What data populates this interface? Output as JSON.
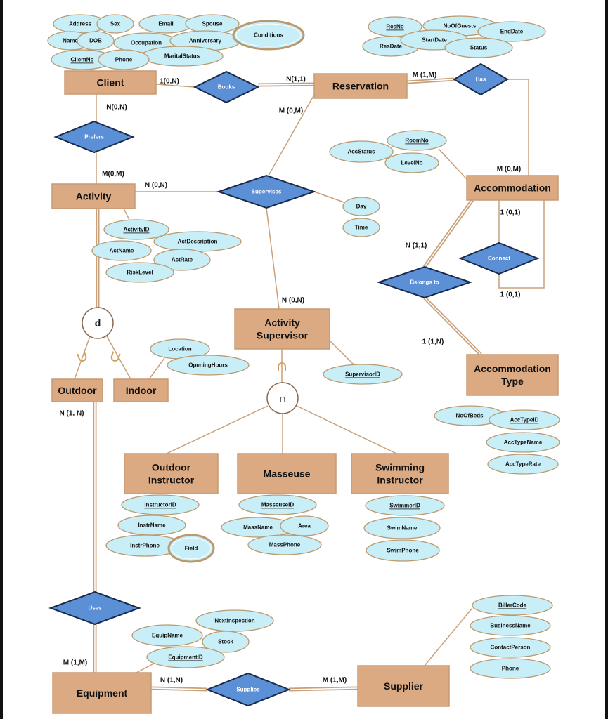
{
  "colors": {
    "entity_fill": "#dcaa82",
    "entity_stroke": "#c79a72",
    "relationship_fill": "#5b8fd6",
    "relationship_stroke": "#1a2a4a",
    "attribute_fill": "#c8eef8",
    "attribute_stroke": "#b99a70",
    "line": "#c8a07a"
  },
  "entities": {
    "client": "Client",
    "reservation": "Reservation",
    "accommodation": "Accommodation",
    "activity": "Activity",
    "activity_supervisor": "Activity Supervisor",
    "outdoor": "Outdoor",
    "indoor": "Indoor",
    "accommodation_type": "Accommodation Type",
    "outdoor_instructor": "Outdoor Instructor",
    "masseuse": "Masseuse",
    "swimming_instructor": "Swimming Instructor",
    "equipment": "Equipment",
    "supplier": "Supplier"
  },
  "relationships": {
    "books": "Books",
    "has": "Has",
    "prefers": "Prefers",
    "supervises": "Supervises",
    "connect": "Connect",
    "belongs_to": "Belongs to",
    "uses": "Uses",
    "supplies": "Supplies"
  },
  "specialization": {
    "disjoint": "d",
    "overlap": "∩"
  },
  "attributes": {
    "client": {
      "address": "Address",
      "sex": "Sex",
      "email": "Email",
      "spouse": "Spouse",
      "name": "Name",
      "dob": "DOB",
      "occupation": "Occupation",
      "anniversary": "Anniversary",
      "conditions": "Conditions",
      "client_no": "ClientNo",
      "phone": "Phone",
      "marital_status": "MaritalStatus"
    },
    "reservation": {
      "res_no": "ResNo",
      "no_of_guests": "NoOfGuests",
      "end_date": "EndDate",
      "res_date": "ResDate",
      "start_date": "StartDate",
      "status": "Status"
    },
    "accommodation": {
      "room_no": "RoomNo",
      "acc_status": "AccStatus",
      "level_no": "LevelNo"
    },
    "supervises": {
      "day": "Day",
      "time": "Time"
    },
    "activity": {
      "activity_id": "ActivityID",
      "act_description": "ActDescription",
      "act_name": "ActName",
      "act_rate": "ActRate",
      "risk_level": "RiskLevel"
    },
    "indoor": {
      "location": "Location",
      "opening_hours": "OpeningHours"
    },
    "activity_supervisor": {
      "supervisor_id": "SupervisorID"
    },
    "accommodation_type": {
      "no_of_beds": "NoOfBeds",
      "acc_type_id": "AccTypeID",
      "acc_type_name": "AccTypeName",
      "acc_type_rate": "AccTypeRate"
    },
    "outdoor_instructor": {
      "instructor_id": "InstructorID",
      "instr_name": "InstrName",
      "instr_phone": "InstrPhone",
      "field": "Field"
    },
    "masseuse": {
      "masseuse_id": "MasseuseID",
      "mass_name": "MassName",
      "area": "Area",
      "mass_phone": "MassPhone"
    },
    "swimming_instructor": {
      "swimmer_id": "SwimmerID",
      "swim_name": "SwimName",
      "swim_phone": "SwimPhone"
    },
    "equipment": {
      "next_inspection": "NextInspection",
      "equip_name": "EquipName",
      "stock": "Stock",
      "equipment_id": "EquipmentID"
    },
    "supplier": {
      "biller_code": "BillerCode",
      "business_name": "BusinessName",
      "contact_person": "ContactPerson",
      "phone": "Phone"
    }
  },
  "cardinalities": {
    "client_books": "1(0,N)",
    "reservation_books": "N(1,1)",
    "client_prefers": "N(0,N)",
    "reservation_supervises": "M (0,M)",
    "reservation_has": "M (1,M)",
    "accommodation_has": "M (0,M)",
    "activity_prefers": "M(0,M)",
    "activity_supervises": "N (0,N)",
    "connect_top": "1 (0,1)",
    "accommodation_belongs": "N (1,1)",
    "connect_bottom": "1 (0,1)",
    "supervisor_supervises": "N (0,N)",
    "acctype_belongs": "1 (1,N)",
    "outdoor_uses": "N (1, N)",
    "equipment_uses": "M (1,M)",
    "equipment_supplies": "N (1,N)",
    "supplier_supplies": "M (1,M)"
  }
}
